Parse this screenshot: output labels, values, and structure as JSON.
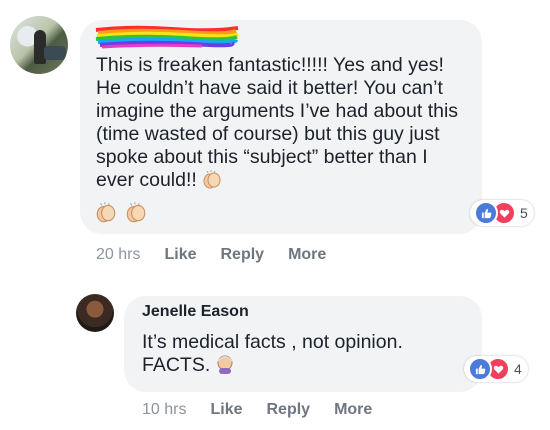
{
  "comments": [
    {
      "author_redacted": true,
      "text": "This is freaken fantastic!!!!! Yes and yes! He couldn’t have said it better! You can’t imagine the arguments I’ve had about this (time wasted of course) but this guy just spoke about this “subject” better than I ever could!!",
      "inline_emoji": "clapping-hands-emoji",
      "trailing_emojis": [
        "clapping-hands-emoji",
        "clapping-hands-emoji"
      ],
      "reactions": {
        "types": [
          "like",
          "love"
        ],
        "count": "5"
      },
      "time": "20 hrs",
      "actions": {
        "like": "Like",
        "reply": "Reply",
        "more": "More"
      }
    },
    {
      "author": "Jenelle Eason",
      "text": "It’s medical facts , not opinion. FACTS.",
      "inline_emoji": "woman-facepalming-emoji",
      "reactions": {
        "types": [
          "like",
          "love"
        ],
        "count": "4"
      },
      "time": "10 hrs",
      "actions": {
        "like": "Like",
        "reply": "Reply",
        "more": "More"
      }
    }
  ],
  "colors": {
    "bubble": "#f2f3f5",
    "text": "#1d2129",
    "meta": "#6f7680",
    "like": "#4a7bd8",
    "love": "#f0405d"
  }
}
